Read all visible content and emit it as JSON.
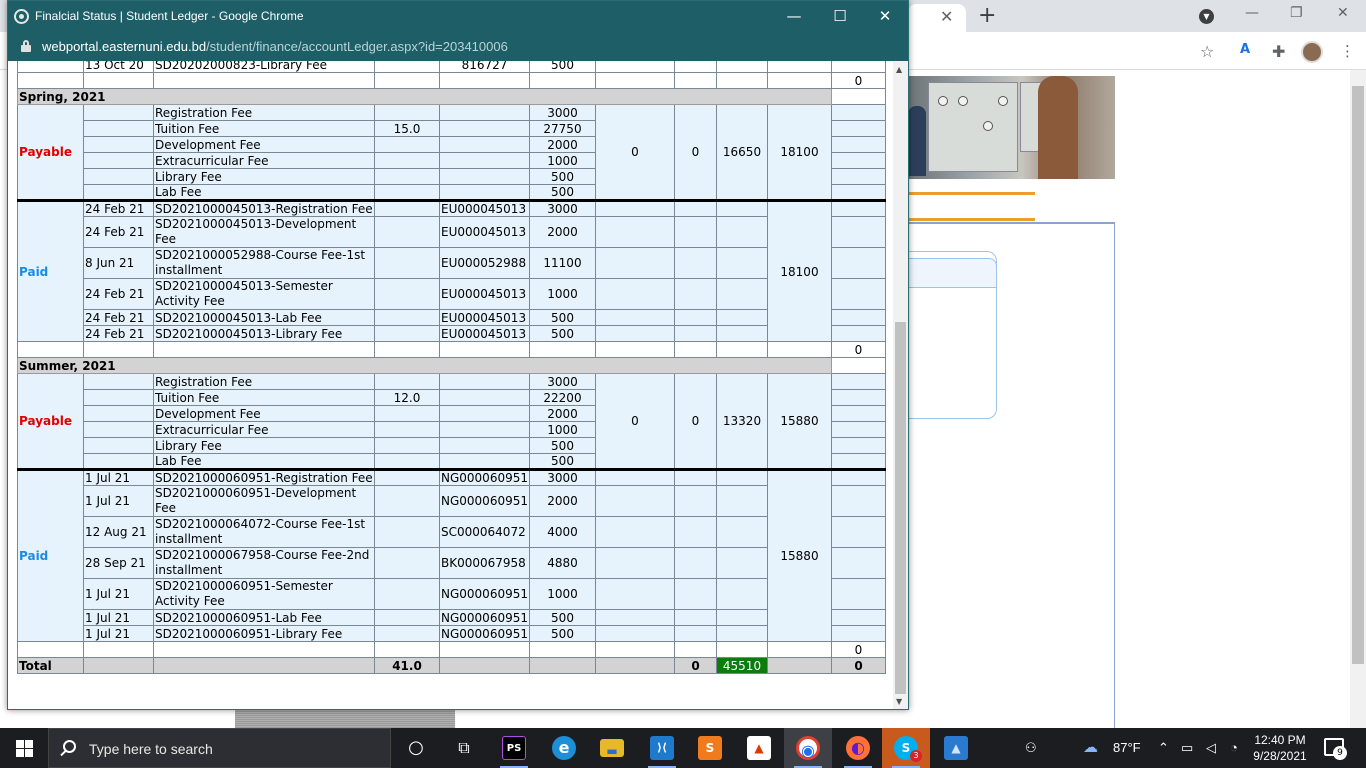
{
  "popup": {
    "title": "Finalcial Status | Student Ledger - Google Chrome",
    "url_host": "webportal.easternuni.edu.bd",
    "url_path": "/student/finance/accountLedger.aspx?id=203410006",
    "controls": {
      "minimize": "—",
      "maximize": "☐",
      "close": "✕"
    }
  },
  "background": {
    "tab_close": "✕",
    "new_tab": "+",
    "window_controls": {
      "minimize": "—",
      "restore": "❐",
      "close": "✕"
    },
    "toolbar_icons": [
      "star-icon",
      "translate-icon",
      "extensions-icon",
      "profile-avatar",
      "menu-icon"
    ]
  },
  "ledger": {
    "top_row": {
      "date": "13 Oct 20",
      "desc": "SD20202000823-Library Fee",
      "ref": "816727",
      "amount": "500"
    },
    "top_balance": "0",
    "spring": {
      "header": "Spring, 2021",
      "payable_label": "Payable",
      "payable_rows": [
        {
          "desc": "Registration Fee",
          "credit": "",
          "amount": "3000"
        },
        {
          "desc": "Tuition Fee",
          "credit": "15.0",
          "amount": "27750"
        },
        {
          "desc": "Development Fee",
          "credit": "",
          "amount": "2000"
        },
        {
          "desc": "Extracurricular Fee",
          "credit": "",
          "amount": "1000"
        },
        {
          "desc": "Library Fee",
          "credit": "",
          "amount": "500"
        },
        {
          "desc": "Lab Fee",
          "credit": "",
          "amount": "500"
        }
      ],
      "waiver": "0",
      "scholarship": "0",
      "discount": "16650",
      "net_payable": "18100",
      "paid_label": "Paid",
      "paid_rows": [
        {
          "date": "24 Feb 21",
          "desc": "SD2021000045013-Registration Fee",
          "ref": "EU000045013",
          "amount": "3000"
        },
        {
          "date": "24 Feb 21",
          "desc": "SD2021000045013-Development Fee",
          "ref": "EU000045013",
          "amount": "2000"
        },
        {
          "date": "8 Jun 21",
          "desc": "SD2021000052988-Course Fee-1st installment",
          "ref": "EU000052988",
          "amount": "11100"
        },
        {
          "date": "24 Feb 21",
          "desc": "SD2021000045013-Semester Activity Fee",
          "ref": "EU000045013",
          "amount": "1000"
        },
        {
          "date": "24 Feb 21",
          "desc": "SD2021000045013-Lab Fee",
          "ref": "EU000045013",
          "amount": "500"
        },
        {
          "date": "24 Feb 21",
          "desc": "SD2021000045013-Library Fee",
          "ref": "EU000045013",
          "amount": "500"
        }
      ],
      "total_paid": "18100",
      "balance": "0"
    },
    "summer": {
      "header": "Summer, 2021",
      "payable_label": "Payable",
      "payable_rows": [
        {
          "desc": "Registration Fee",
          "credit": "",
          "amount": "3000"
        },
        {
          "desc": "Tuition Fee",
          "credit": "12.0",
          "amount": "22200"
        },
        {
          "desc": "Development Fee",
          "credit": "",
          "amount": "2000"
        },
        {
          "desc": "Extracurricular Fee",
          "credit": "",
          "amount": "1000"
        },
        {
          "desc": "Library Fee",
          "credit": "",
          "amount": "500"
        },
        {
          "desc": "Lab Fee",
          "credit": "",
          "amount": "500"
        }
      ],
      "waiver": "0",
      "scholarship": "0",
      "discount": "13320",
      "net_payable": "15880",
      "paid_label": "Paid",
      "paid_rows": [
        {
          "date": "1 Jul 21",
          "desc": "SD2021000060951-Registration Fee",
          "ref": "NG000060951",
          "amount": "3000"
        },
        {
          "date": "1 Jul 21",
          "desc": "SD2021000060951-Development Fee",
          "ref": "NG000060951",
          "amount": "2000"
        },
        {
          "date": "12 Aug 21",
          "desc": "SD2021000064072-Course Fee-1st installment",
          "ref": "SC000064072",
          "amount": "4000"
        },
        {
          "date": "28 Sep 21",
          "desc": "SD2021000067958-Course Fee-2nd installment",
          "ref": "BK000067958",
          "amount": "4880"
        },
        {
          "date": "1 Jul 21",
          "desc": "SD2021000060951-Semester Activity Fee",
          "ref": "NG000060951",
          "amount": "1000"
        },
        {
          "date": "1 Jul 21",
          "desc": "SD2021000060951-Lab Fee",
          "ref": "NG000060951",
          "amount": "500"
        },
        {
          "date": "1 Jul 21",
          "desc": "SD2021000060951-Library Fee",
          "ref": "NG000060951",
          "amount": "500"
        }
      ],
      "total_paid": "15880",
      "balance": "0"
    },
    "total": {
      "label": "Total",
      "credit": "41.0",
      "scholarship": "0",
      "discount": "45510",
      "balance": "0"
    }
  },
  "taskbar": {
    "search_placeholder": "Type here to search",
    "apps": [
      {
        "name": "cortana",
        "glyph": "○"
      },
      {
        "name": "task-view",
        "glyph": "⧉"
      },
      {
        "name": "phpstorm",
        "glyph": "PS"
      },
      {
        "name": "edge",
        "glyph": "e"
      },
      {
        "name": "file-explorer",
        "glyph": "▬"
      },
      {
        "name": "vscode",
        "glyph": "⟩⟨"
      },
      {
        "name": "sublime-text",
        "glyph": "S"
      },
      {
        "name": "office",
        "glyph": "▲"
      },
      {
        "name": "chrome",
        "glyph": "◉"
      },
      {
        "name": "firefox",
        "glyph": "◐"
      },
      {
        "name": "skype",
        "glyph": "S"
      },
      {
        "name": "photos",
        "glyph": "▲"
      }
    ],
    "temperature": "87°F",
    "time": "12:40 PM",
    "date": "9/28/2021",
    "notification_count": "9",
    "skype_badge": "3"
  },
  "colors": {
    "popup_title_bg": "#1e5f67",
    "payable": "#e00000",
    "paid": "#1c8ce0",
    "cell_blue": "#e6f3fc",
    "total_discount": "#0e7b0e"
  }
}
